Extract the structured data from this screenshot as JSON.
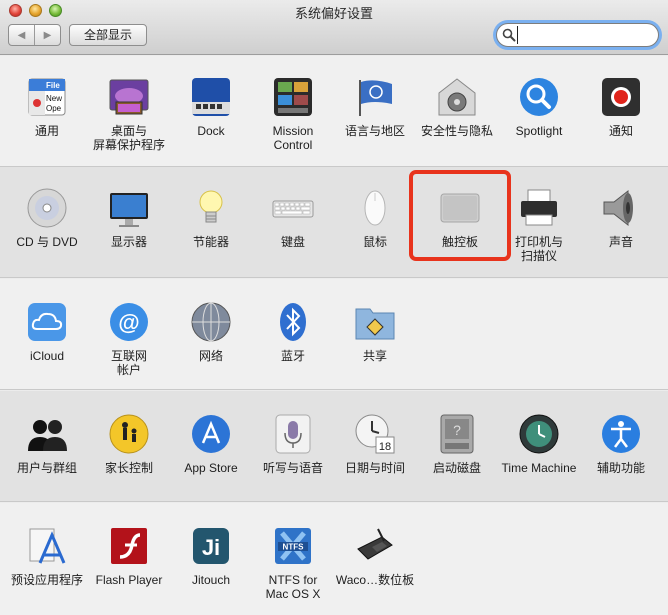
{
  "window": {
    "title": "系统偏好设置"
  },
  "toolbar": {
    "back_glyph": "◀",
    "forward_glyph": "▶",
    "show_all_label": "全部显示",
    "search_value": "",
    "search_placeholder": ""
  },
  "sections": [
    {
      "panes": [
        {
          "label": "通用",
          "icon": "general-icon"
        },
        {
          "label": "桌面与\n屏幕保护程序",
          "icon": "desktop-screensaver-icon"
        },
        {
          "label": "Dock",
          "icon": "dock-icon"
        },
        {
          "label": "Mission\nControl",
          "icon": "mission-control-icon"
        },
        {
          "label": "语言与地区",
          "icon": "language-region-icon"
        },
        {
          "label": "安全性与隐私",
          "icon": "security-privacy-icon"
        },
        {
          "label": "Spotlight",
          "icon": "spotlight-icon"
        },
        {
          "label": "通知",
          "icon": "notifications-icon"
        }
      ]
    },
    {
      "panes": [
        {
          "label": "CD 与 DVD",
          "icon": "cd-dvd-icon"
        },
        {
          "label": "显示器",
          "icon": "displays-icon"
        },
        {
          "label": "节能器",
          "icon": "energy-saver-icon"
        },
        {
          "label": "键盘",
          "icon": "keyboard-icon"
        },
        {
          "label": "鼠标",
          "icon": "mouse-icon"
        },
        {
          "label": "触控板",
          "icon": "trackpad-icon"
        },
        {
          "label": "打印机与\n扫描仪",
          "icon": "printers-scanners-icon"
        },
        {
          "label": "声音",
          "icon": "sound-icon"
        }
      ]
    },
    {
      "panes": [
        {
          "label": "iCloud",
          "icon": "icloud-icon"
        },
        {
          "label": "互联网\n帐户",
          "icon": "internet-accounts-icon"
        },
        {
          "label": "网络",
          "icon": "network-icon"
        },
        {
          "label": "蓝牙",
          "icon": "bluetooth-icon"
        },
        {
          "label": "共享",
          "icon": "sharing-icon"
        }
      ]
    },
    {
      "panes": [
        {
          "label": "用户与群组",
          "icon": "users-groups-icon"
        },
        {
          "label": "家长控制",
          "icon": "parental-controls-icon"
        },
        {
          "label": "App Store",
          "icon": "app-store-icon"
        },
        {
          "label": "听写与语音",
          "icon": "dictation-speech-icon"
        },
        {
          "label": "日期与时间",
          "icon": "date-time-icon"
        },
        {
          "label": "启动磁盘",
          "icon": "startup-disk-icon"
        },
        {
          "label": "Time Machine",
          "icon": "time-machine-icon"
        },
        {
          "label": "辅助功能",
          "icon": "accessibility-icon"
        }
      ]
    },
    {
      "panes": [
        {
          "label": "预设应用程序",
          "icon": "default-apps-icon"
        },
        {
          "label": "Flash Player",
          "icon": "flash-player-icon"
        },
        {
          "label": "Jitouch",
          "icon": "jitouch-icon"
        },
        {
          "label": "NTFS for\nMac OS X",
          "icon": "ntfs-icon"
        },
        {
          "label": "Waco…数位板",
          "icon": "wacom-tablet-icon"
        }
      ]
    }
  ],
  "icon_text": {
    "general_file": "File",
    "general_new": "New",
    "general_open": "Ope",
    "calendar_day": "18",
    "jitouch": "Ji",
    "ntfs": "NTFS"
  },
  "colors": {
    "highlight": "#e8331c",
    "search_focus": "#7ab0f0"
  }
}
